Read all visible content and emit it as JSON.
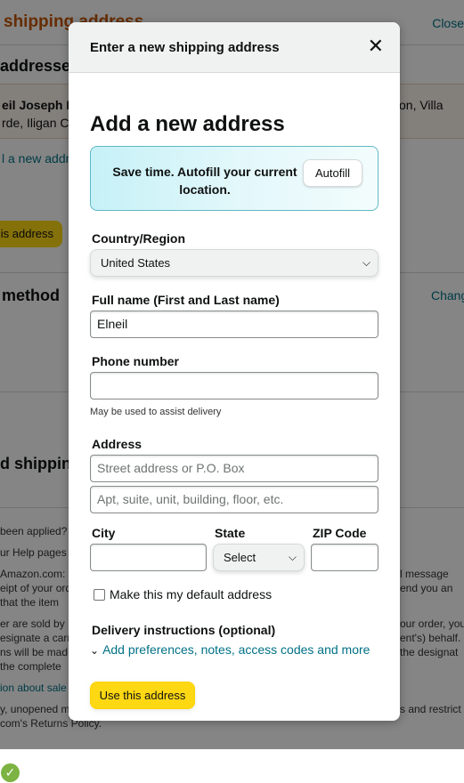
{
  "background": {
    "title": "shipping address",
    "close_link": "Close",
    "addresses_heading": "addresses",
    "address_line1": "eil Joseph E",
    "address_line2": "rde, Iligan Ci",
    "address_right1": "on, Villa",
    "add_new_link": "l a new addr",
    "use_address_btn": "is address",
    "method_heading": "method",
    "change_link": "Chang",
    "shipping_heading": "d shippin",
    "small_lines_left": [
      "been applied?",
      "ur Help pages",
      "Amazon.com:",
      "eipt of your ord",
      "that the item",
      "er are sold by",
      "esignate a carri",
      "ns will be mad",
      "the complete",
      "ion about sale",
      "y, unopened m",
      "com's Returns Policy."
    ],
    "small_lines_right": [
      "l message",
      "end you an",
      "our order, you",
      "ent's) behalf.",
      "the designat",
      "s and restrict"
    ]
  },
  "modal": {
    "header_title": "Enter a new shipping address",
    "close_icon": "✕",
    "heading": "Add a new address",
    "autofill_text": "Save time. Autofill your current location.",
    "autofill_button": "Autofill",
    "country_label": "Country/Region",
    "country_value": "United States",
    "fullname_label": "Full name (First and Last name)",
    "fullname_value": "Elneil",
    "phone_label": "Phone number",
    "phone_value": "",
    "phone_hint": "May be used to assist delivery",
    "address_label": "Address",
    "street_placeholder": "Street address or P.O. Box",
    "apt_placeholder": "Apt, suite, unit, building, floor, etc.",
    "city_label": "City",
    "state_label": "State",
    "state_value": "Select",
    "zip_label": "ZIP Code",
    "default_checkbox_label": "Make this my default address",
    "delivery_label": "Delivery instructions (optional)",
    "delivery_link": "Add preferences, notes, access codes and more",
    "submit_button": "Use this address"
  },
  "colors": {
    "accent_link": "#007185",
    "primary_button": "#ffd814",
    "title_orange": "#c45500",
    "success_green": "#7cb342"
  },
  "icons": {
    "close": "close-icon",
    "chevron_down": "chevron-down-icon",
    "success": "check-circle-icon"
  }
}
